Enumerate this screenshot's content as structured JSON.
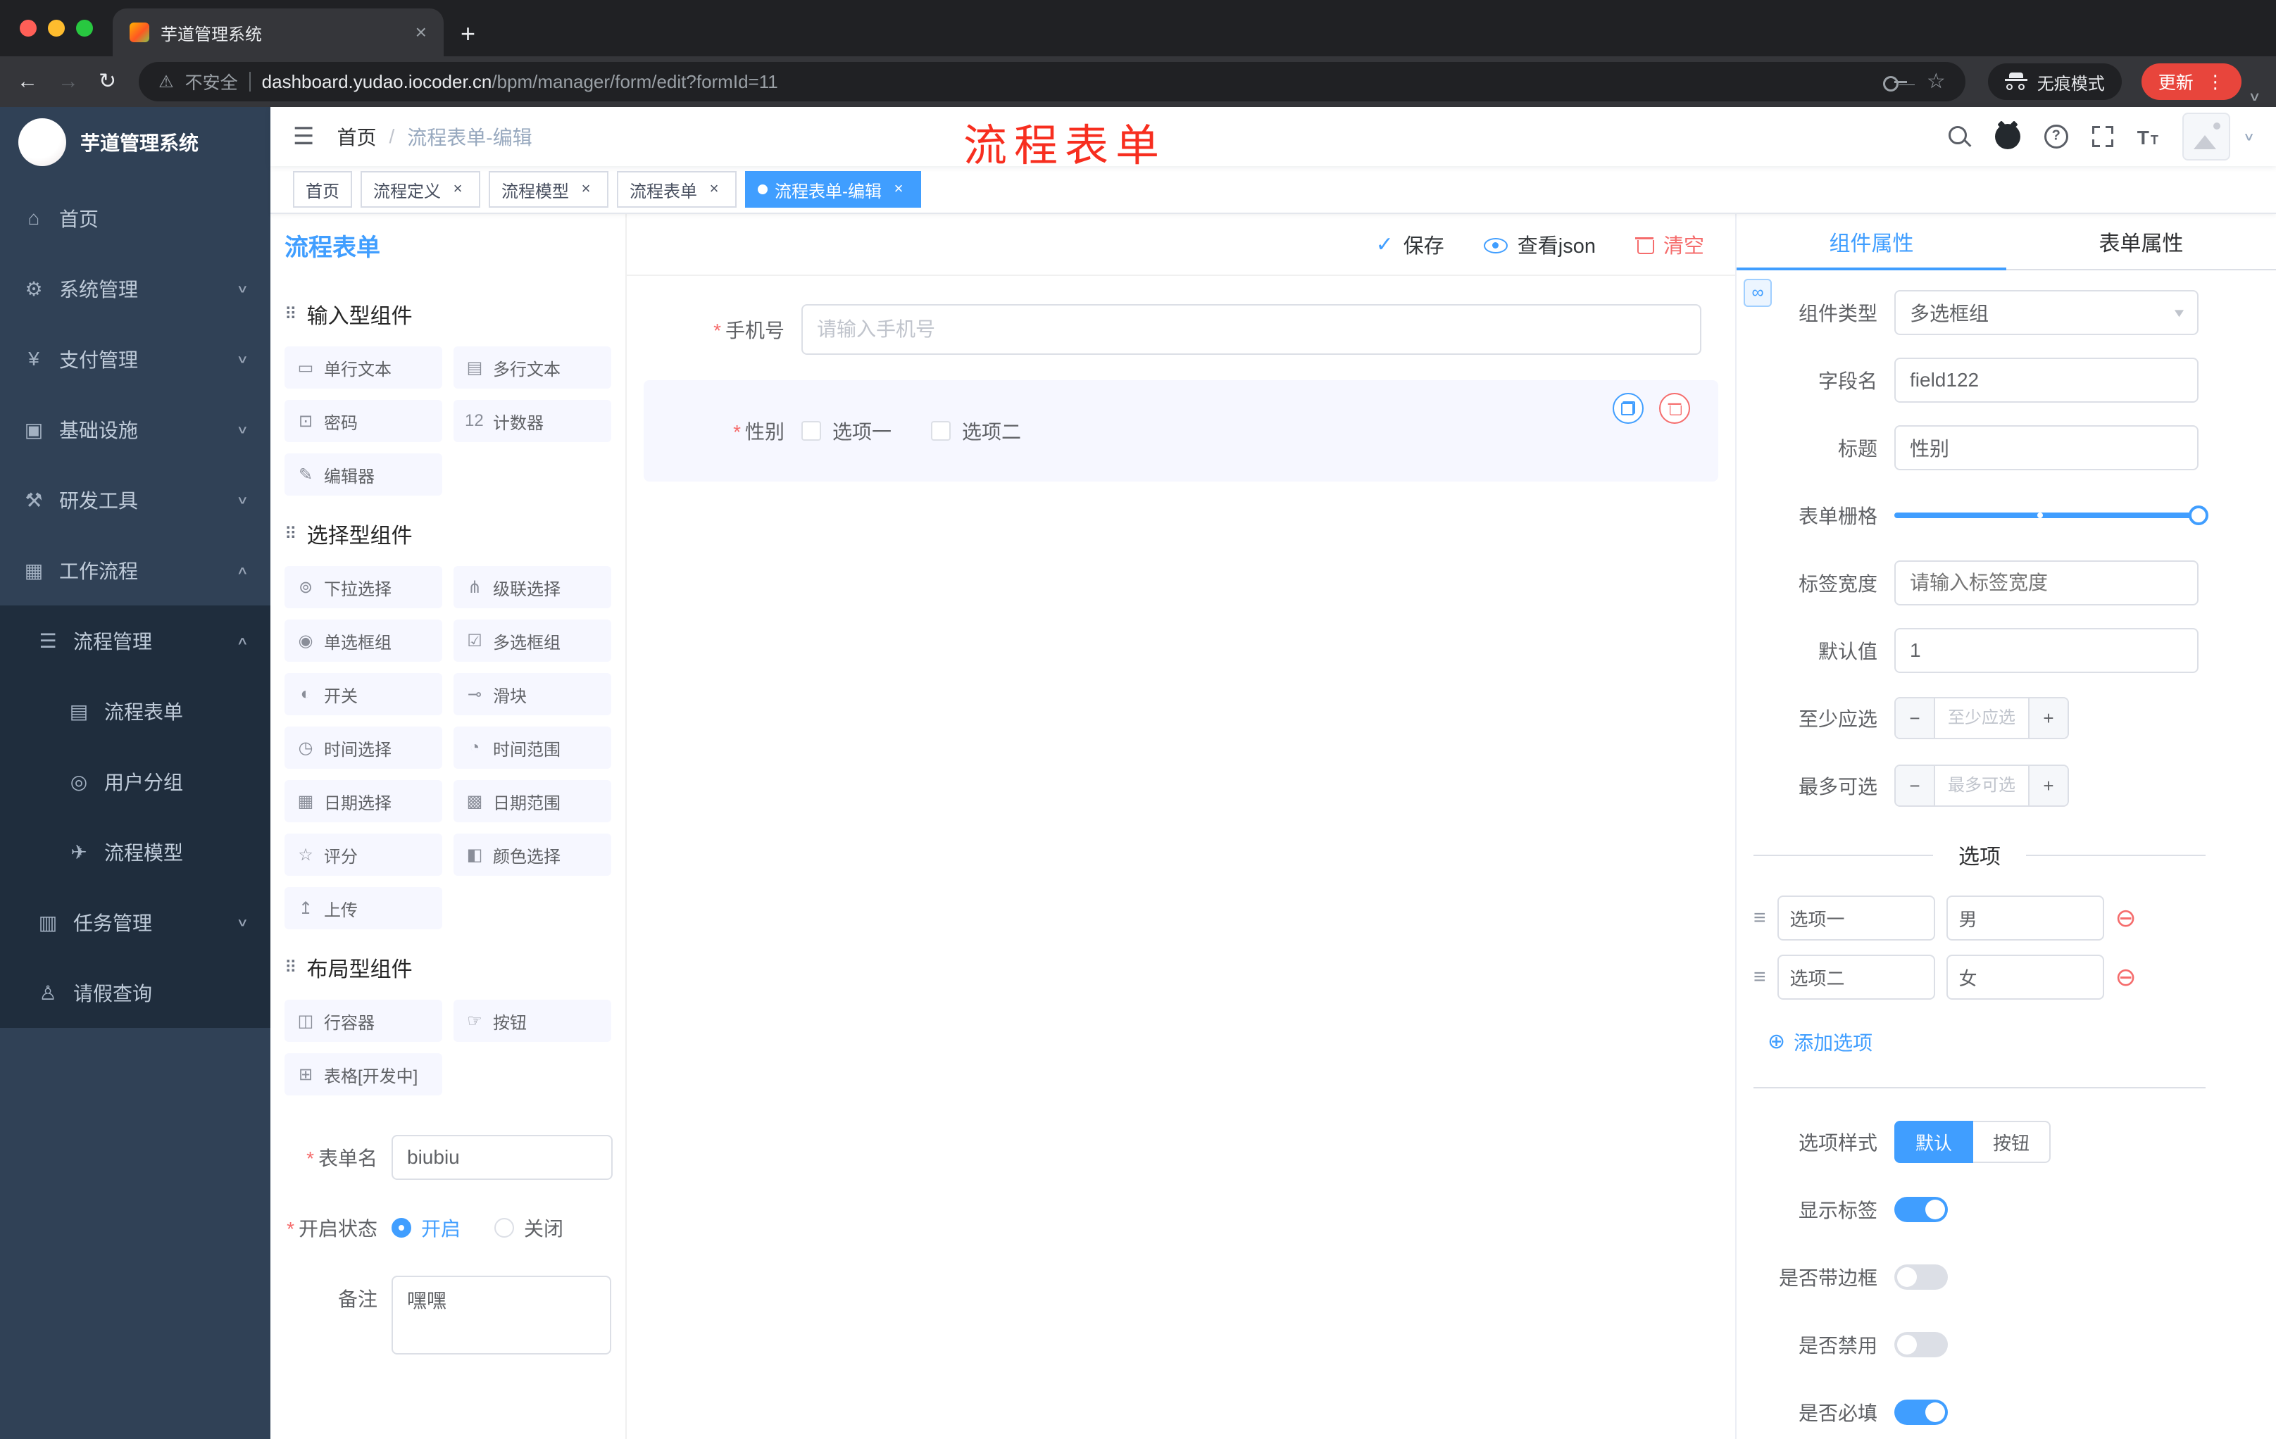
{
  "colors": {
    "primary": "#409eff",
    "danger": "#f56c6c",
    "sidebar_bg": "#304156",
    "annotation_red": "#f72e1f"
  },
  "icons": {
    "nav_back": "←",
    "nav_forward": "→",
    "nav_reload": "↻",
    "warning": "⚠",
    "star": "☆",
    "menu_dots": "⋮",
    "caret_down": "∨",
    "tab_close": "×",
    "new_tab": "+",
    "hamburger": "☰",
    "breadcrumb_sep": "/",
    "check": "✓",
    "select_caret": "▾",
    "link": "∞",
    "drag": "⠿",
    "option_drag": "≡",
    "minus_circle": "⊖",
    "plus_circle": "⊕",
    "minus": "−",
    "plus": "+",
    "required_star": "*"
  },
  "browser": {
    "tab_title": "芋道管理系统",
    "security_label": "不安全",
    "url_domain": "dashboard.yudao.iocoder.cn",
    "url_path": "/bpm/manager/form/edit?formId=11",
    "incognito_label": "无痕模式",
    "update_label": "更新"
  },
  "sidebar": {
    "title": "芋道管理系统",
    "items": [
      {
        "label": "首页",
        "icon": "⌂",
        "chev": "",
        "cls": "lvl0"
      },
      {
        "label": "系统管理",
        "icon": "⚙",
        "chev": "∨",
        "cls": "lvl0"
      },
      {
        "label": "支付管理",
        "icon": "¥",
        "chev": "∨",
        "cls": "lvl0"
      },
      {
        "label": "基础设施",
        "icon": "▣",
        "chev": "∨",
        "cls": "lvl0"
      },
      {
        "label": "研发工具",
        "icon": "⚒",
        "chev": "∨",
        "cls": "lvl0"
      },
      {
        "label": "工作流程",
        "icon": "▦",
        "chev": "∧",
        "cls": "lvl0"
      },
      {
        "label": "流程管理",
        "icon": "☰",
        "chev": "∧",
        "cls": "lvl1"
      },
      {
        "label": "流程表单",
        "icon": "▤",
        "chev": "",
        "cls": "lvl2"
      },
      {
        "label": "用户分组",
        "icon": "◎",
        "chev": "",
        "cls": "lvl2"
      },
      {
        "label": "流程模型",
        "icon": "✈",
        "chev": "",
        "cls": "lvl2"
      },
      {
        "label": "任务管理",
        "icon": "▥",
        "chev": "∨",
        "cls": "lvl1"
      },
      {
        "label": "请假查询",
        "icon": "♙",
        "chev": "",
        "cls": "lvl1"
      }
    ]
  },
  "header": {
    "breadcrumb_home": "首页",
    "breadcrumb_current": "流程表单-编辑",
    "annotation": "流程表单"
  },
  "tags": [
    {
      "label": "首页"
    },
    {
      "label": "流程定义",
      "closable": true
    },
    {
      "label": "流程模型",
      "closable": true
    },
    {
      "label": "流程表单",
      "closable": true
    },
    {
      "label": "流程表单-编辑",
      "closable": true,
      "active": true
    }
  ],
  "designer": {
    "title": "流程表单",
    "save_label": "保存",
    "view_json_label": "查看json",
    "clear_label": "清空",
    "groups": [
      {
        "title": "输入型组件",
        "items": [
          {
            "label": "单行文本",
            "icon": "▭"
          },
          {
            "label": "多行文本",
            "icon": "▤"
          },
          {
            "label": "密码",
            "icon": "⊡"
          },
          {
            "label": "计数器",
            "icon": "123"
          },
          {
            "label": "编辑器",
            "icon": "✎"
          }
        ]
      },
      {
        "title": "选择型组件",
        "items": [
          {
            "label": "下拉选择",
            "icon": "⊚"
          },
          {
            "label": "级联选择",
            "icon": "⋔"
          },
          {
            "label": "单选框组",
            "icon": "◉"
          },
          {
            "label": "多选框组",
            "icon": "☑"
          },
          {
            "label": "开关",
            "icon": "◐"
          },
          {
            "label": "滑块",
            "icon": "⊸"
          },
          {
            "label": "时间选择",
            "icon": "◷"
          },
          {
            "label": "时间范围",
            "icon": "◔"
          },
          {
            "label": "日期选择",
            "icon": "▦"
          },
          {
            "label": "日期范围",
            "icon": "▩"
          },
          {
            "label": "评分",
            "icon": "☆"
          },
          {
            "label": "颜色选择",
            "icon": "◧"
          },
          {
            "label": "上传",
            "icon": "↥"
          }
        ]
      },
      {
        "title": "布局型组件",
        "items": [
          {
            "label": "行容器",
            "icon": "◫"
          },
          {
            "label": "按钮",
            "icon": "☞"
          },
          {
            "label": "表格[开发中]",
            "icon": "⊞"
          }
        ]
      }
    ],
    "meta": {
      "form_name_label": "表单名",
      "form_name_value": "biubiu",
      "status_label": "开启状态",
      "status_on": "开启",
      "status_off": "关闭",
      "remark_label": "备注",
      "remark_value": "嘿嘿"
    },
    "canvas": {
      "phone_label": "手机号",
      "phone_placeholder": "请输入手机号",
      "gender_label": "性别",
      "gender_options": [
        {
          "label": "选项一"
        },
        {
          "label": "选项二"
        }
      ]
    }
  },
  "props": {
    "tab_component": "组件属性",
    "tab_form": "表单属性",
    "component_type_label": "组件类型",
    "component_type_value": "多选框组",
    "field_name_label": "字段名",
    "field_name_value": "field122",
    "title_label": "标题",
    "title_value": "性别",
    "grid_label": "表单栅格",
    "label_width_label": "标签宽度",
    "label_width_placeholder": "请输入标签宽度",
    "default_label": "默认值",
    "default_value": "1",
    "min_label": "至少应选",
    "min_placeholder": "至少应选",
    "max_label": "最多可选",
    "max_placeholder": "最多可选",
    "options_divider": "选项",
    "options": [
      {
        "label": "选项一",
        "value": "男"
      },
      {
        "label": "选项二",
        "value": "女"
      }
    ],
    "add_option_label": "添加选项",
    "option_style_label": "选项样式",
    "option_style_default": "默认",
    "option_style_button": "按钮",
    "switches": [
      {
        "label": "显示标签",
        "on": true
      },
      {
        "label": "是否带边框",
        "on": false
      },
      {
        "label": "是否禁用",
        "on": false
      },
      {
        "label": "是否必填",
        "on": true
      }
    ]
  }
}
